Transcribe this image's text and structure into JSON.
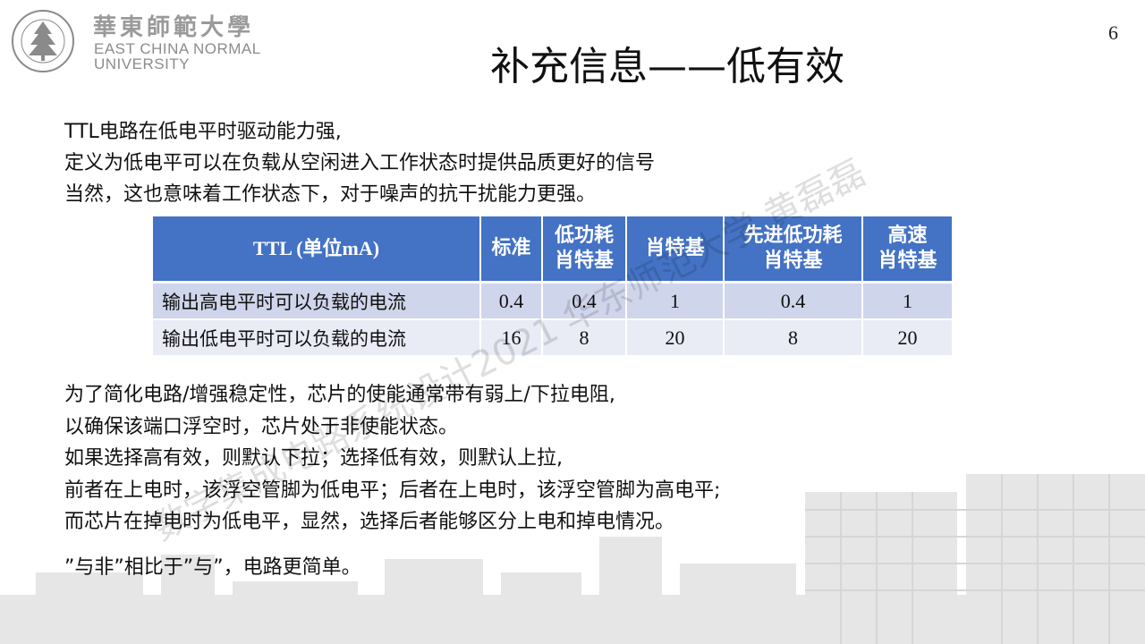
{
  "logo": {
    "cn_name": "華東師範大學",
    "en_line1": "EAST CHINA NORMAL",
    "en_line2": "UNIVERSITY",
    "seal_text": "EAST CHINA NORMAL UNIVERSITY"
  },
  "page_number": "6",
  "title": "补充信息——低有效",
  "intro": {
    "lines": [
      "TTL电路在低电平时驱动能力强,",
      "定义为低电平可以在负载从空闲进入工作状态时提供品质更好的信号",
      "当然，这也意味着工作状态下，对于噪声的抗干扰能力更强。"
    ]
  },
  "table": {
    "headers": [
      [
        "TTL (单位mA)"
      ],
      [
        "标准"
      ],
      [
        "低功耗",
        "肖特基"
      ],
      [
        "肖特基"
      ],
      [
        "先进低功耗",
        "肖特基"
      ],
      [
        "高速",
        "肖特基"
      ]
    ],
    "rows": [
      [
        "输出高电平时可以负载的电流",
        "0.4",
        "0.4",
        "1",
        "0.4",
        "1"
      ],
      [
        "输出低电平时可以负载的电流",
        "16",
        "8",
        "20",
        "8",
        "20"
      ]
    ],
    "header_color": "#4472c4",
    "row_colors": [
      "#cfd5ea",
      "#e9ebf5"
    ]
  },
  "body": {
    "lines": [
      "为了简化电路/增强稳定性，芯片的使能通常带有弱上/下拉电阻,",
      "以确保该端口浮空时，芯片处于非使能状态。",
      "如果选择高有效，则默认下拉；选择低有效，则默认上拉,",
      "前者在上电时，该浮空管脚为低电平；后者在上电时，该浮空管脚为高电平;",
      "而芯片在掉电时为低电平，显然，选择后者能够区分上电和掉电情况。"
    ]
  },
  "conclusion": "”与非”相比于”与”，电路更简单。",
  "watermark": "数字集成电路系统设计2021 华东师范大学 黄磊磊"
}
